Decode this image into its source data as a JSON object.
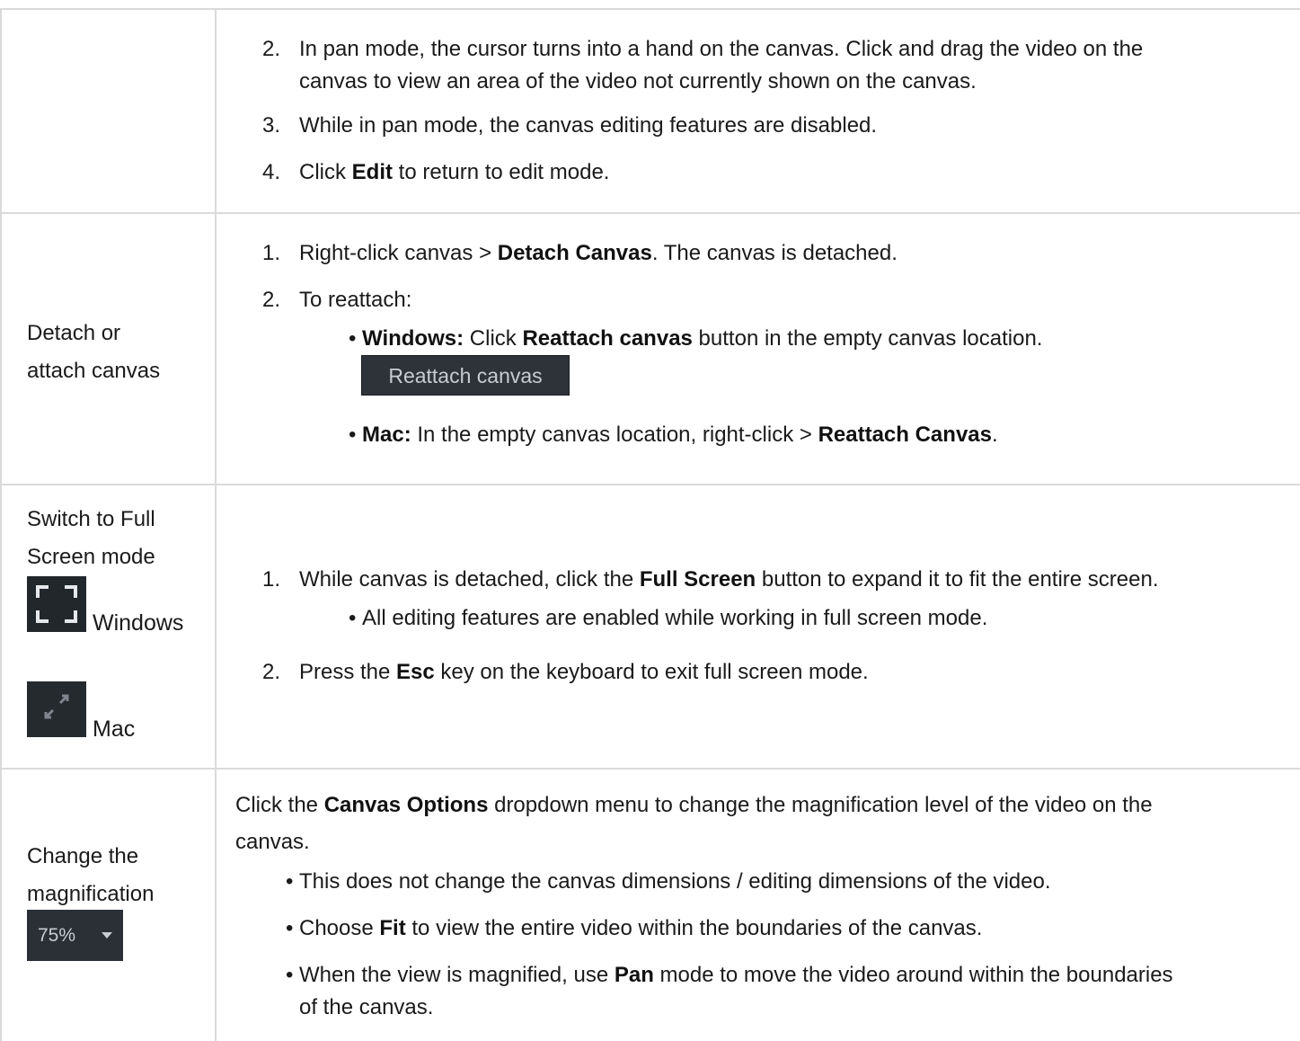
{
  "rows": {
    "pan": {
      "step2_num": "2.",
      "step2_line1": "In pan mode, the cursor turns into a hand on the canvas. Click and drag the video on the",
      "step2_line2": "canvas to view an area of the video not currently shown on the canvas.",
      "step3_num": "3.",
      "step3": "While in pan mode, the canvas editing features are disabled.",
      "step4_num": "4.",
      "step4_pre": "Click ",
      "step4_bold": "Edit",
      "step4_post": " to return to edit mode."
    },
    "detach": {
      "label_line1": "Detach or",
      "label_line2": "attach canvas",
      "step1_num": "1.",
      "step1_pre": "Right-click canvas > ",
      "step1_bold": "Detach Canvas",
      "step1_post": ". The canvas is detached.",
      "step2_num": "2.",
      "step2": "To reattach:",
      "bullet_windows_bold1": "Windows:",
      "bullet_windows_pre": " Click ",
      "bullet_windows_bold2": "Reattach canvas",
      "bullet_windows_post": " button in the empty canvas location.",
      "reattach_button_label": "Reattach canvas",
      "bullet_mac_bold1": "Mac:",
      "bullet_mac_pre": " In the empty canvas location, right-click > ",
      "bullet_mac_bold2": "Reattach Canvas",
      "bullet_mac_post": "."
    },
    "fullscreen": {
      "label_line1": "Switch to Full",
      "label_line2": "Screen mode",
      "windows_caption": "Windows",
      "mac_caption": "Mac",
      "step1_num": "1.",
      "step1_pre": "While canvas is detached, click the ",
      "step1_bold": "Full Screen",
      "step1_post": " button to expand it to fit the entire screen.",
      "step1_bullet": "All editing features are enabled while working in full screen mode.",
      "step2_num": "2.",
      "step2_pre": "Press the ",
      "step2_bold": "Esc",
      "step2_post": " key on the keyboard to exit full screen mode."
    },
    "magnification": {
      "label_line1": "Change the",
      "label_line2": "magnification",
      "zoom_value": "75%",
      "intro_pre": "Click the ",
      "intro_bold": "Canvas Options",
      "intro_post": " dropdown menu to change the magnification level of the video on the",
      "intro_line2": "canvas.",
      "bullet1": "This does not change the canvas dimensions / editing dimensions of the video.",
      "bullet2_pre": "Choose ",
      "bullet2_bold": "Fit",
      "bullet2_post": " to view the entire video within the boundaries of the canvas.",
      "bullet3_pre": "When the view is magnified, use ",
      "bullet3_bold": "Pan",
      "bullet3_post": " mode to move the video around within the boundaries",
      "bullet3_line2": "of the canvas."
    }
  },
  "icons": {
    "windows_fullscreen": "fullscreen-brackets-icon",
    "mac_fullscreen": "expand-arrows-icon",
    "bullet_glyph": "•"
  },
  "colors": {
    "dark_control_bg": "#2e3339",
    "grid_line": "#dadada"
  }
}
